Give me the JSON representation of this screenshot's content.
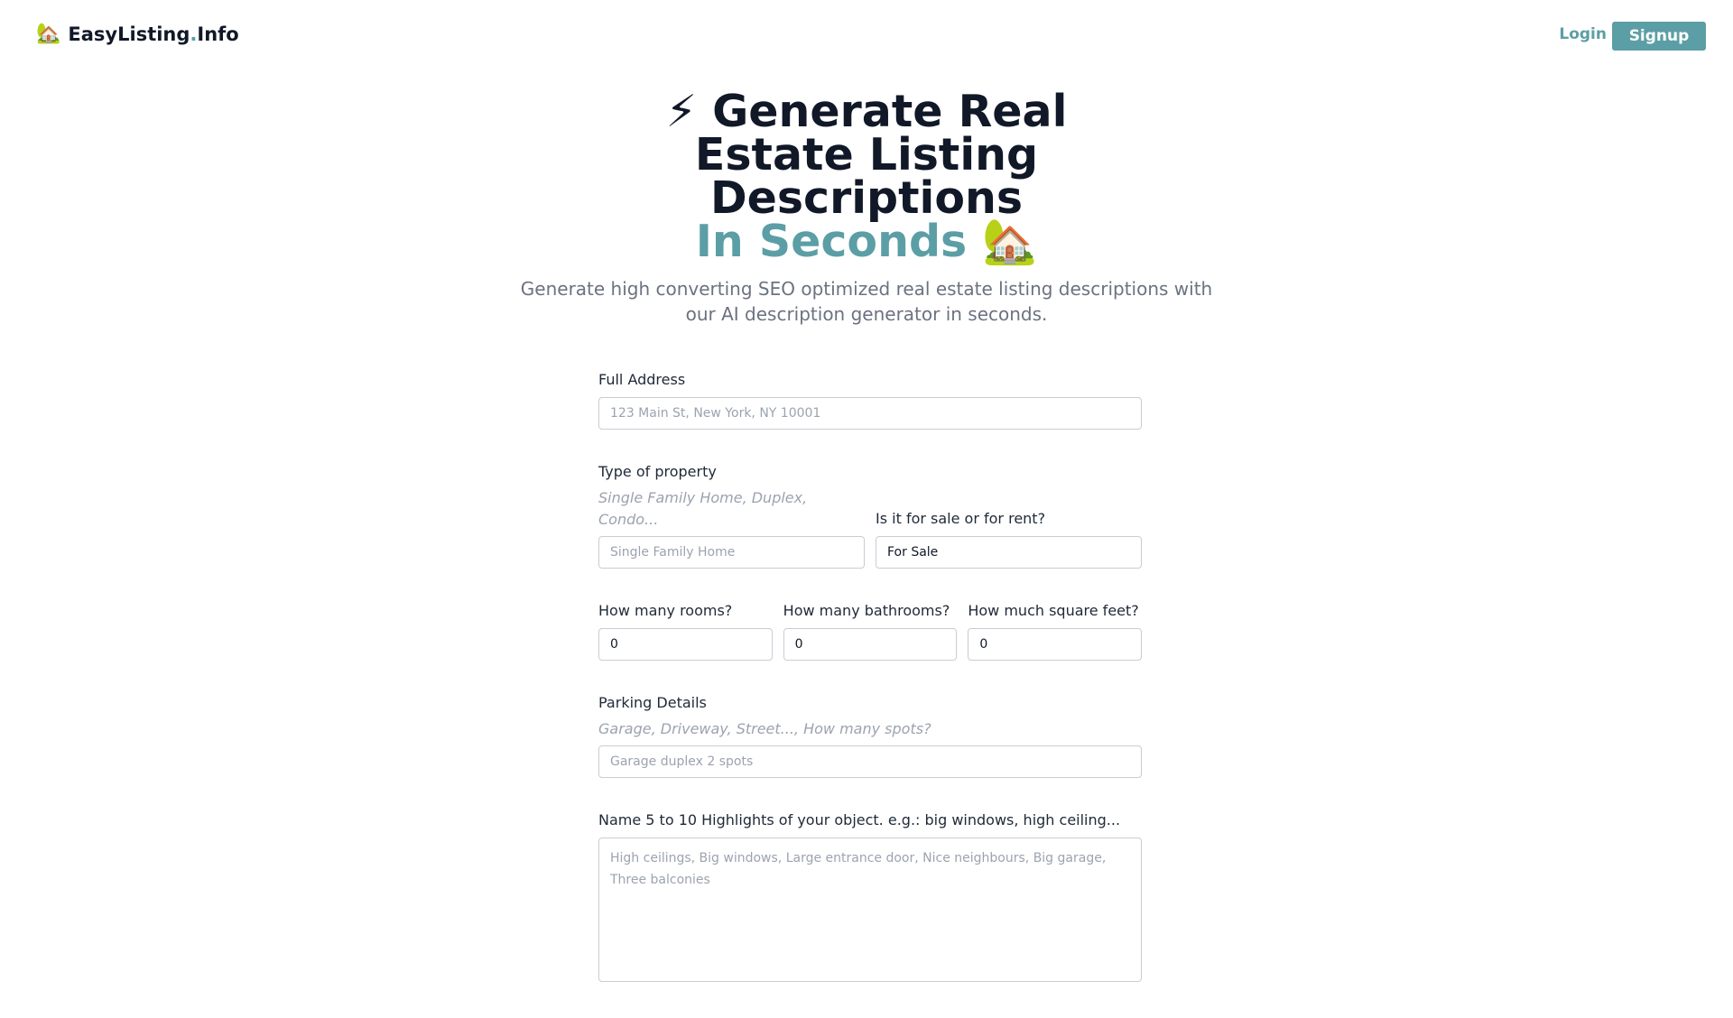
{
  "header": {
    "brand_icon": "🏡",
    "brand_name": "EasyListing",
    "brand_dot": ".",
    "brand_tld": "Info",
    "login_label": "Login",
    "signup_label": "Signup"
  },
  "hero": {
    "title_icon": "⚡",
    "title_main": "Generate Real Estate Listing Descriptions",
    "title_accent": "In Seconds",
    "title_accent_icon": "🏡",
    "subtitle": "Generate high converting SEO optimized real estate listing descriptions with our AI description generator in seconds."
  },
  "form": {
    "address": {
      "label": "Full Address",
      "placeholder": "123 Main St, New York, NY 10001",
      "value": ""
    },
    "property_type": {
      "label": "Type of property",
      "hint": "Single Family Home, Duplex, Condo...",
      "placeholder": "Single Family Home",
      "value": ""
    },
    "sale_or_rent": {
      "label": "Is it for sale or for rent?",
      "value": "For Sale"
    },
    "rooms": {
      "label": "How many rooms?",
      "value": "0"
    },
    "bathrooms": {
      "label": "How many bathrooms?",
      "value": "0"
    },
    "square_feet": {
      "label": "How much square feet?",
      "value": "0"
    },
    "parking": {
      "label": "Parking Details",
      "hint": "Garage, Driveway, Street..., How many spots?",
      "placeholder": "Garage duplex 2 spots",
      "value": ""
    },
    "highlights": {
      "label": "Name 5 to 10 Highlights of your object. e.g.: big windows, high ceiling...",
      "placeholder": "High ceilings, Big windows, Large entrance door, Nice neighbours, Big garage, Three balconies",
      "value": ""
    }
  },
  "colors": {
    "accent": "#5c9ea5",
    "heading": "#111827",
    "muted": "#6b7280",
    "hint": "#9ca3af"
  }
}
